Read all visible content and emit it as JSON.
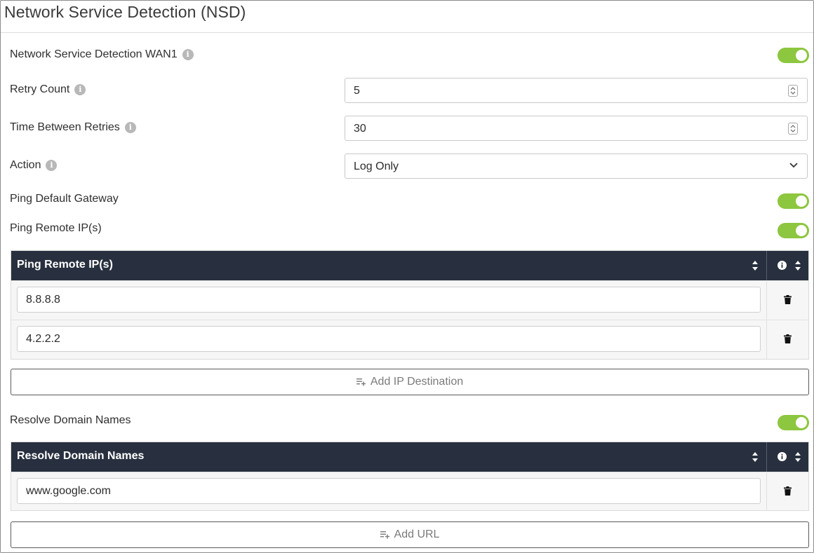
{
  "page": {
    "title": "Network Service Detection (NSD)"
  },
  "settings": {
    "nsd_wan1": {
      "label": "Network Service Detection WAN1",
      "enabled": true
    },
    "retry_count": {
      "label": "Retry Count",
      "value": "5"
    },
    "time_between_retries": {
      "label": "Time Between Retries",
      "value": "30"
    },
    "action": {
      "label": "Action",
      "selected": "Log Only"
    },
    "ping_default_gateway": {
      "label": "Ping Default Gateway",
      "enabled": true
    },
    "ping_remote_ips": {
      "label": "Ping Remote IP(s)",
      "enabled": true
    },
    "resolve_domain_names": {
      "label": "Resolve Domain Names",
      "enabled": true
    }
  },
  "ping_table": {
    "header": "Ping Remote IP(s)",
    "rows": [
      "8.8.8.8",
      "4.2.2.2"
    ],
    "add_label": "Add IP Destination"
  },
  "domain_table": {
    "header": "Resolve Domain Names",
    "rows": [
      "www.google.com"
    ],
    "add_label": "Add URL"
  },
  "colors": {
    "toggle_on": "#8dc63f",
    "table_header": "#28303f",
    "info_icon": "#b8b8b8"
  },
  "icons": [
    "info-icon",
    "sort-icon",
    "trash-icon",
    "chevron-down-icon",
    "spinner-icon",
    "add-list-icon"
  ]
}
